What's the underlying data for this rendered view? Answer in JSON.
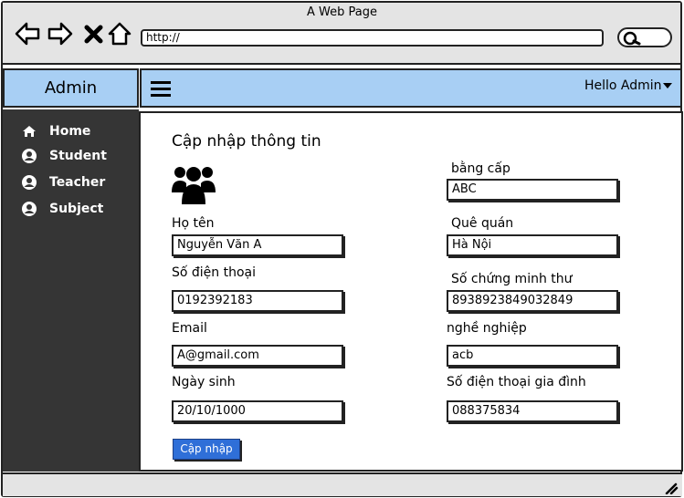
{
  "window": {
    "title": "A Web Page",
    "url": "http://"
  },
  "header": {
    "brand": "Admin",
    "greeting": "Hello Admin"
  },
  "sidebar": {
    "items": [
      {
        "label": "Home",
        "icon": "home-icon"
      },
      {
        "label": "Student",
        "icon": "user-icon"
      },
      {
        "label": "Teacher",
        "icon": "user-icon"
      },
      {
        "label": "Subject",
        "icon": "user-icon"
      }
    ]
  },
  "form": {
    "title": "Cập nhập thông tin",
    "left": [
      {
        "label": "Họ tên",
        "value": "Nguyễn Văn A"
      },
      {
        "label": "Số điện thoại",
        "value": "0192392183"
      },
      {
        "label": "Email",
        "value": "A@gmail.com"
      },
      {
        "label": "Ngày sinh",
        "value": "20/10/1000"
      }
    ],
    "right": [
      {
        "label": "bằng cấp",
        "value": "ABC"
      },
      {
        "label": "Quê quán",
        "value": "Hà Nội"
      },
      {
        "label": "Số chứng minh thư",
        "value": "8938923849032849"
      },
      {
        "label": "nghề nghiệp",
        "value": "acb"
      },
      {
        "label": "Số điện thoại gia đình",
        "value": "088375834"
      }
    ],
    "submit_label": "Cập nhập"
  },
  "colors": {
    "accent": "#a8cff4",
    "sidebar": "#353535",
    "button": "#2f6fd8",
    "chrome": "#e4e4e4"
  }
}
